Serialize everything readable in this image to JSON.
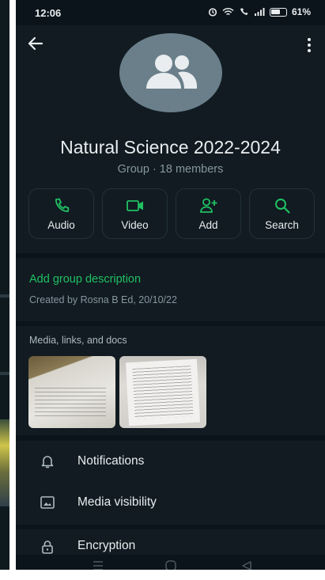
{
  "status_bar": {
    "time": "12:06",
    "battery": "61%"
  },
  "header": {
    "group_name": "Natural Science 2022-2024",
    "group_meta": "Group · 18 members"
  },
  "actions": [
    {
      "label": "Audio",
      "icon": "phone-icon"
    },
    {
      "label": "Video",
      "icon": "video-icon"
    },
    {
      "label": "Add",
      "icon": "add-person-icon"
    },
    {
      "label": "Search",
      "icon": "search-icon"
    }
  ],
  "description": {
    "link": "Add group description",
    "created_by": "Created by Rosna B Ed, 20/10/22"
  },
  "media": {
    "title": "Media, links, and docs"
  },
  "settings": {
    "notifications": "Notifications",
    "media_visibility": "Media visibility",
    "encryption": "Encryption"
  },
  "colors": {
    "accent_green": "#21c063",
    "background": "#0b141a",
    "panel": "#111b21",
    "primary_text": "#e9edef",
    "secondary_text": "#8696a0"
  }
}
